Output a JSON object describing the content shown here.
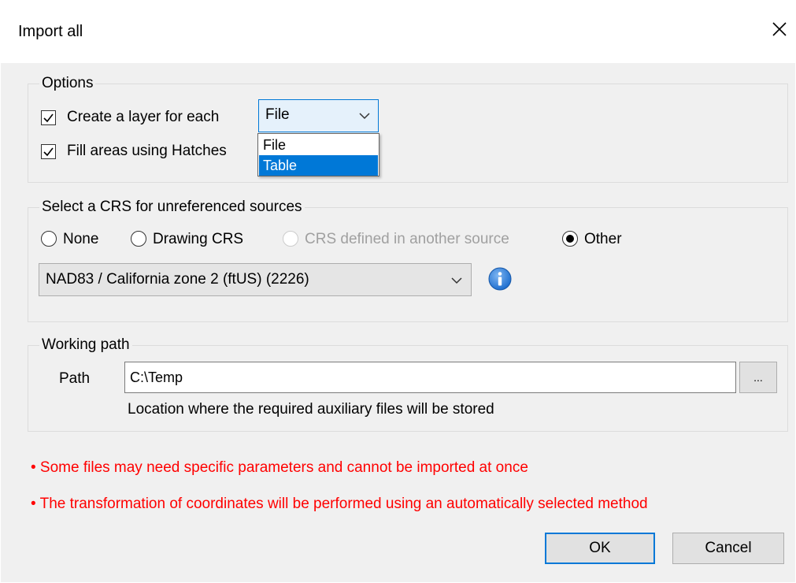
{
  "window": {
    "title": "Import all"
  },
  "options": {
    "legend": "Options",
    "create_layer_label": "Create a layer for each",
    "create_layer_checked": true,
    "layer_combo_value": "File",
    "dropdown_options": [
      "File",
      "Table"
    ],
    "dropdown_selected": "Table",
    "fill_hatches_label": "Fill areas using Hatches",
    "fill_hatches_checked": true
  },
  "crs": {
    "legend": "Select a CRS for unreferenced sources",
    "radios": [
      {
        "label": "None",
        "checked": false,
        "enabled": true
      },
      {
        "label": "Drawing CRS",
        "checked": false,
        "enabled": true
      },
      {
        "label": "CRS defined in another source",
        "checked": false,
        "enabled": false
      },
      {
        "label": "Other",
        "checked": true,
        "enabled": true
      }
    ],
    "combo_value": "NAD83 / California zone 2 (ftUS) (2226)"
  },
  "working_path": {
    "legend": "Working path",
    "path_label": "Path",
    "path_value": "C:\\Temp",
    "browse_label": "...",
    "hint": "Location where the required auxiliary files will be stored"
  },
  "warnings": [
    "• Some files may need specific parameters and cannot be imported at once",
    "• The transformation of coordinates will be performed using an automatically selected method"
  ],
  "buttons": {
    "ok": "OK",
    "cancel": "Cancel"
  },
  "colors": {
    "accent": "#0078d7",
    "warning": "#ff0000",
    "dialog_bg": "#f0f0f0",
    "info_icon": "#1f6fcf"
  }
}
